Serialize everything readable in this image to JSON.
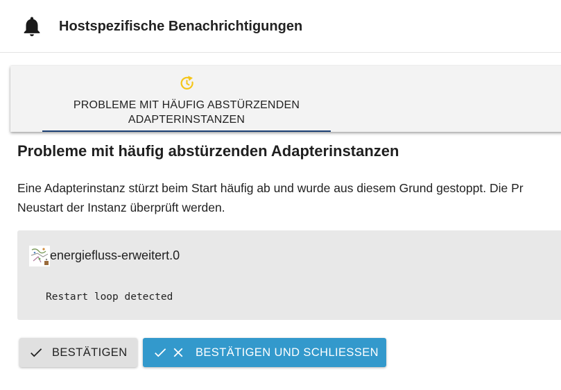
{
  "header": {
    "title": "Hostspezifische Benachrichtigungen",
    "icon": "bell-icon"
  },
  "tabs": [
    {
      "label_line1": "PROBLEME MIT HÄUFIG ABSTÜRZENDEN",
      "label_line2": "ADAPTERINSTANZEN",
      "icon": "restart-clock-icon",
      "selected": true
    }
  ],
  "content": {
    "title": "Probleme mit häufig abstürzenden Adapterinstanzen",
    "description_line1": "Eine Adapterinstanz stürzt beim Start häufig ab und wurde aus diesem Grund gestoppt. Die Pr",
    "description_line2": "Neustart der Instanz überprüft werden.",
    "instance": {
      "name": "energiefluss-erweitert.0",
      "message": "Restart loop detected"
    }
  },
  "buttons": {
    "confirm_label": "BESTÄTIGEN",
    "confirm_close_label": "BESTÄTIGEN UND SCHLIESSEN"
  },
  "colors": {
    "accent_icon": "#f5c518",
    "tab_indicator": "#1c3f74",
    "primary_button": "#3399cc"
  }
}
